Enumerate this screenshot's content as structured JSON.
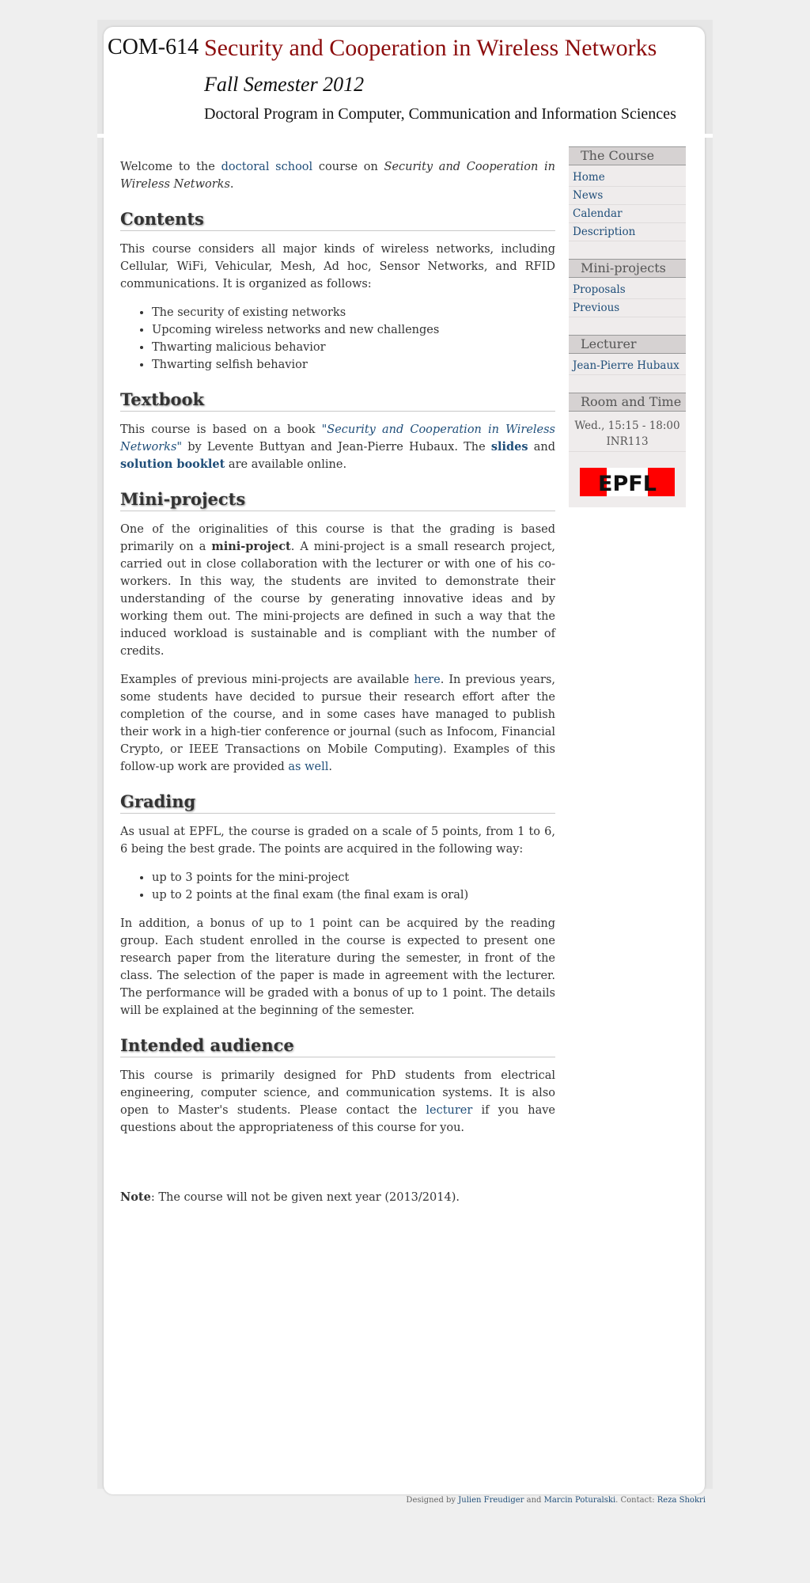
{
  "header": {
    "course_code": "COM-614",
    "course_title": "Security and Cooperation in Wireless Networks",
    "semester": "Fall Semester 2012",
    "program": "Doctoral Program in Computer, Communication and Information Sciences"
  },
  "main": {
    "welcome": {
      "before": "Welcome to the ",
      "link": "doctoral school",
      "middle": " course on ",
      "course_name": "Security and Cooperation in Wireless Networks",
      "after": "."
    },
    "contents": {
      "heading": "Contents",
      "intro": "This course considers all major kinds of wireless networks, including Cellular, WiFi, Vehicular, Mesh, Ad hoc, Sensor Networks, and RFID communications. It is organized as follows:",
      "items": [
        "The security of existing networks",
        "Upcoming wireless networks and new challenges",
        "Thwarting malicious behavior",
        "Thwarting selfish behavior"
      ]
    },
    "textbook": {
      "heading": "Textbook",
      "before": "This course is based on a book ",
      "book_link": "\"Security and Cooperation in Wireless Networks\"",
      "middle": " by Levente Buttyan and Jean-Pierre Hubaux. The ",
      "slides_link": "slides",
      "and": " and ",
      "booklet_link": "solution booklet",
      "after": " are available online."
    },
    "miniprojects": {
      "heading": "Mini-projects",
      "p1_before": "One of the originalities of this course is that the grading is based primarily on a ",
      "p1_bold": "mini-project",
      "p1_after": ". A mini-project is a small research project, carried out in close collaboration with the lecturer or with one of his co-workers. In this way, the students are invited to demonstrate their understanding of the course by generating innovative ideas and by working them out. The mini-projects are defined in such a way that the induced workload is sustainable and is compliant with the number of credits.",
      "p2_before": "Examples of previous mini-projects are available ",
      "p2_link_here": "here",
      "p2_middle": ". In previous years, some students have decided to pursue their research effort after the completion of the course, and in some cases have managed to publish their work in a high-tier conference or journal (such as Infocom, Financial Crypto, or IEEE Transactions on Mobile Computing). Examples of this follow-up work are provided ",
      "p2_link_aswell": "as well",
      "p2_after": "."
    },
    "grading": {
      "heading": "Grading",
      "intro": "As usual at EPFL, the course is graded on a scale of 5 points, from 1 to 6, 6 being the best grade. The points are acquired in the following way:",
      "items": [
        "up to 3 points for the mini-project",
        "up to 2 points at the final exam (the final exam is oral)"
      ],
      "bonus": "In addition, a bonus of up to 1 point can be acquired by the reading group. Each student enrolled in the course is expected to present one research paper from the literature during the semester, in front of the class. The selection of the paper is made in agreement with the lecturer. The performance will be graded with a bonus of up to 1 point. The details will be explained at the beginning of the semester."
    },
    "audience": {
      "heading": "Intended audience",
      "before": "This course is primarily designed for PhD students from electrical engineering, computer science, and communication systems. It is also open to Master's students. Please contact the ",
      "link": "lecturer",
      "after": " if you have questions about the appropriateness of this course for you."
    },
    "note": {
      "label": "Note",
      "text": ": The course will not be given next year (2013/2014)."
    }
  },
  "sidebar": {
    "course": {
      "title": "The Course",
      "items": [
        "Home",
        "News",
        "Calendar",
        "Description"
      ]
    },
    "miniprojects": {
      "title": "Mini-projects",
      "items": [
        "Proposals",
        "Previous"
      ]
    },
    "lecturer": {
      "title": "Lecturer",
      "name": "Jean-Pierre Hubaux"
    },
    "room_time": {
      "title": "Room and Time",
      "time": "Wed., 15:15 - 18:00",
      "room": "INR113"
    },
    "logo_text": "EPFL"
  },
  "footer": {
    "designed_by": "Designed by ",
    "designer1": "Julien Freudiger",
    "and": " and ",
    "designer2": "Marcin Poturalski",
    "contact_label": ". Contact: ",
    "contact": "Reza Shokri"
  },
  "colors": {
    "title_red": "#8c0d0d",
    "link_blue": "#1f4e79",
    "logo_red": "#ff0000"
  }
}
